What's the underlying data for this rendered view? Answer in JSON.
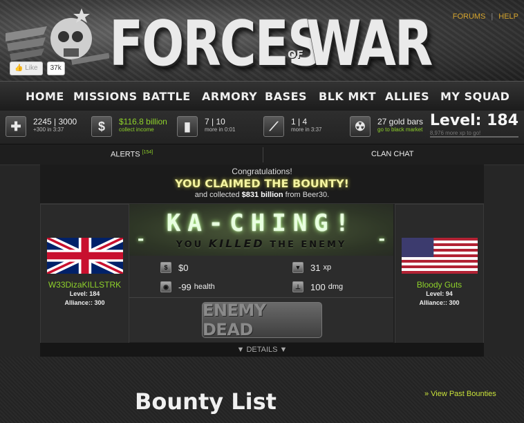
{
  "header": {
    "logo_main": "FORCES",
    "logo_of": "OF",
    "logo_war": "WAR",
    "links": [
      "FORUMS",
      "HELP"
    ],
    "like_label": "Like",
    "like_count": "37k"
  },
  "nav": {
    "items": [
      "HOME",
      "MISSIONS",
      "BATTLE",
      "ARMORY",
      "BASES",
      "BLK MKT",
      "ALLIES",
      "MY SQUAD"
    ]
  },
  "stats": {
    "health": {
      "main": "2245 | 3000",
      "sub": "+300 in 3:37",
      "icon": "medic-cross-icon"
    },
    "money": {
      "main": "$116.8 billion",
      "sub": "collect income",
      "icon": "dollar-icon"
    },
    "energy": {
      "main": "7 | 10",
      "sub": "more in 0:01",
      "icon": "energy-icon"
    },
    "ammo": {
      "main": "1 | 4",
      "sub": "more in 3:37",
      "icon": "ammo-icon"
    },
    "gold": {
      "main": "27 gold bars",
      "sub": "go to black market",
      "icon": "gold-icon"
    },
    "level": {
      "main": "Level: 184",
      "sub": "8,976 more xp to go!"
    }
  },
  "tabs": {
    "alerts": "ALERTS",
    "alerts_count": "[154]",
    "clan_chat": "CLAN CHAT"
  },
  "result": {
    "line1": "Congratulations!",
    "line2": "YOU CLAIMED THE BOUNTY!",
    "line3_pre": "and collected",
    "line3_amount": "$831 billion",
    "line3_post": "from Beer30."
  },
  "player": {
    "name": "W33DizaKILLSTRK",
    "level": "Level: 184",
    "alliance": "Alliance:: 300",
    "flag": "uk-flag"
  },
  "enemy": {
    "name": "Bloody Guts",
    "level": "Level: 94",
    "alliance": "Alliance:: 300",
    "flag": "us-flag"
  },
  "kaching": {
    "title": "KA-CHING!",
    "sub_pre": "YOU",
    "sub_killed": "KILLED",
    "sub_post": "THE ENEMY"
  },
  "rewards": {
    "money": "$0",
    "xp": "31",
    "xp_unit": "xp",
    "health": "-99",
    "health_unit": "health",
    "dmg": "100",
    "dmg_unit": "dmg"
  },
  "enemy_dead_label": "ENEMY DEAD",
  "details_label": "▼ DETAILS ▼",
  "bounty": {
    "title": "Bounty List",
    "past_link": "View Past Bounties"
  }
}
